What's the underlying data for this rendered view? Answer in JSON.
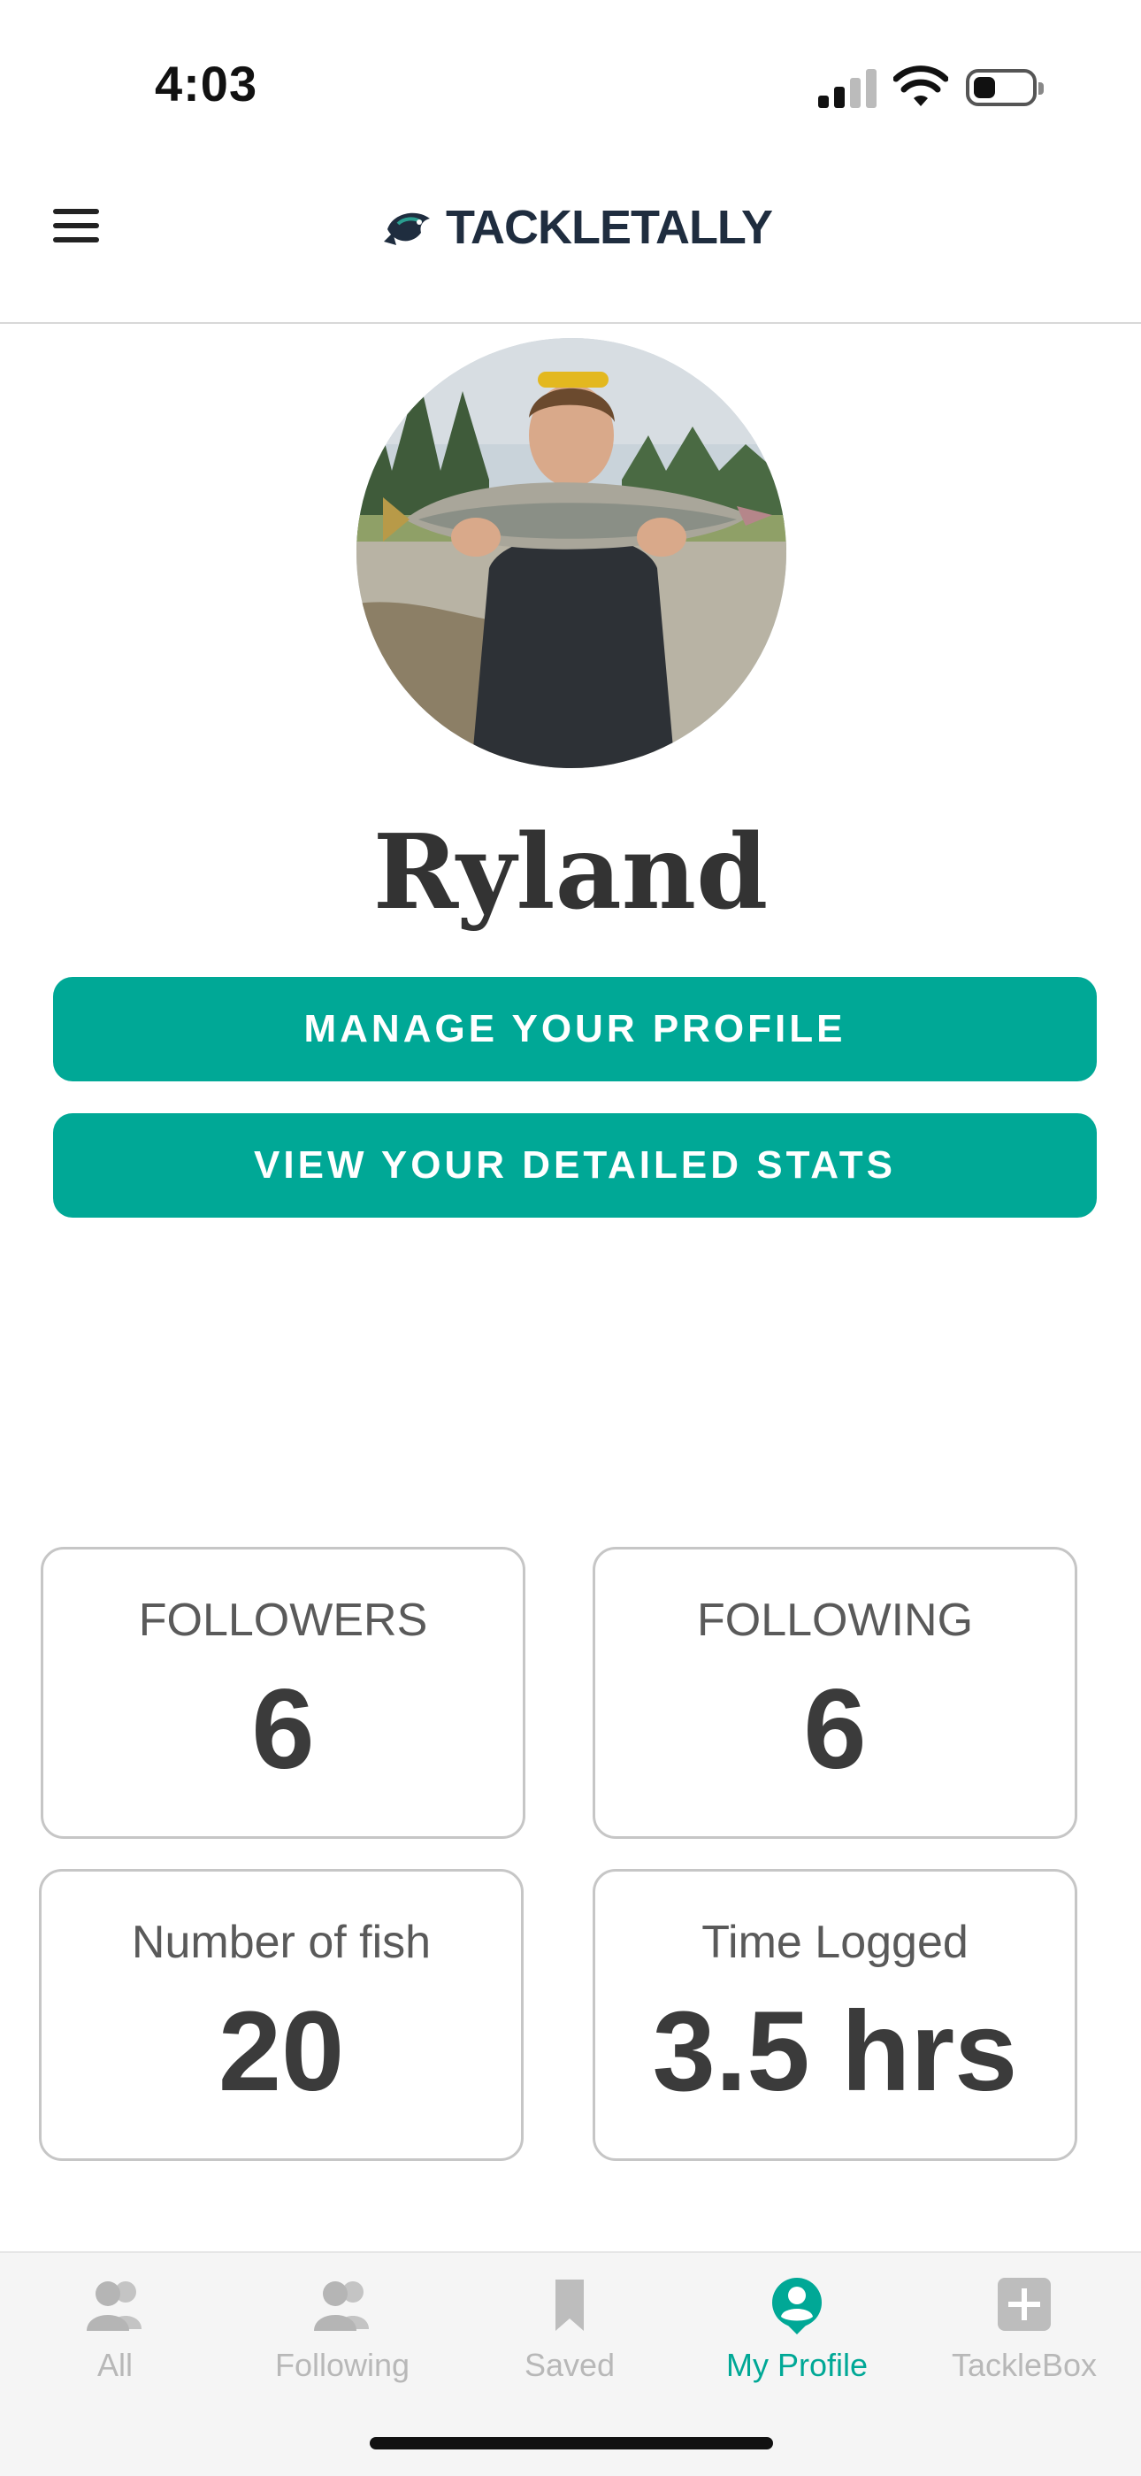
{
  "status_bar": {
    "time": "4:03"
  },
  "header": {
    "logo_text": "TACKLETALLY",
    "menu_icon": "hamburger-menu-icon",
    "logo_icon": "fish-logo-icon"
  },
  "profile": {
    "name": "Ryland",
    "avatar": "angler-holding-salmon-photo",
    "buttons": {
      "manage": "MANAGE YOUR PROFILE",
      "stats": "VIEW YOUR DETAILED STATS"
    }
  },
  "stats": {
    "followers": {
      "label": "FOLLOWERS",
      "value": "6"
    },
    "following": {
      "label": "FOLLOWING",
      "value": "6"
    },
    "fish": {
      "label": "Number of fish",
      "value": "20"
    },
    "time": {
      "label": "Time Logged",
      "value": "3.5 hrs"
    }
  },
  "nav": {
    "items": [
      {
        "label": "All",
        "icon": "people-icon"
      },
      {
        "label": "Following",
        "icon": "people-icon"
      },
      {
        "label": "Saved",
        "icon": "bookmark-icon"
      },
      {
        "label": "My Profile",
        "icon": "profile-icon",
        "active": true
      },
      {
        "label": "TackleBox",
        "icon": "plus-box-icon"
      }
    ]
  },
  "colors": {
    "accent": "#00a896",
    "text_dark": "#333333",
    "nav_inactive": "#b8b8b8",
    "logo_navy": "#1f2d3f"
  }
}
